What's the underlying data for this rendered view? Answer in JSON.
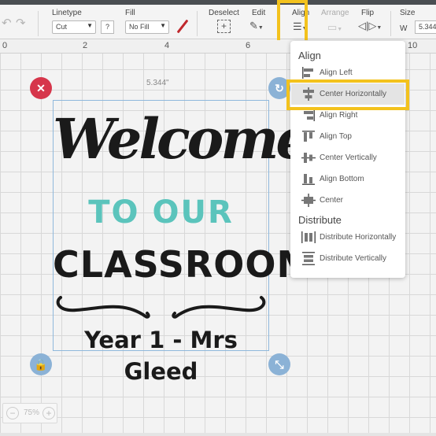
{
  "toolbar": {
    "linetype_label": "Linetype",
    "linetype_value": "Cut",
    "linetype_help": "?",
    "fill_label": "Fill",
    "fill_value": "No Fill",
    "deselect_label": "Deselect",
    "edit_label": "Edit",
    "align_label": "Align",
    "arrange_label": "Arrange",
    "flip_label": "Flip",
    "size_label": "Size",
    "size_w_label": "W",
    "size_w_value": "5.344"
  },
  "ruler": {
    "ticks": [
      "0",
      "2",
      "4",
      "6",
      "10"
    ]
  },
  "canvas": {
    "dimension_label": "5.344\"",
    "zoom_value": "75%",
    "zoom_out": "−",
    "zoom_in": "+"
  },
  "artwork": {
    "line1": "Welcome",
    "line2": "TO OUR",
    "line3": "CLASSROOM",
    "line4": "Year 1 - Mrs Gleed",
    "colors": {
      "main": "#1a1a1a",
      "accent": "#5bc4bc"
    }
  },
  "align_menu": {
    "align_heading": "Align",
    "align_items": [
      {
        "label": "Align Left",
        "icon": "align-left-icon"
      },
      {
        "label": "Center Horizontally",
        "icon": "center-horizontally-icon",
        "active": true
      },
      {
        "label": "Align Right",
        "icon": "align-right-icon"
      },
      {
        "label": "Align Top",
        "icon": "align-top-icon"
      },
      {
        "label": "Center Vertically",
        "icon": "center-vertically-icon"
      },
      {
        "label": "Align Bottom",
        "icon": "align-bottom-icon"
      },
      {
        "label": "Center",
        "icon": "center-icon"
      }
    ],
    "distribute_heading": "Distribute",
    "distribute_items": [
      {
        "label": "Distribute Horizontally",
        "icon": "distribute-horizontally-icon"
      },
      {
        "label": "Distribute Vertically",
        "icon": "distribute-vertically-icon"
      }
    ]
  },
  "colors": {
    "highlight": "#f3c21d",
    "close_handle": "#d6364b",
    "handle": "#8bb2d6",
    "selection_border": "#8fb8dc"
  }
}
